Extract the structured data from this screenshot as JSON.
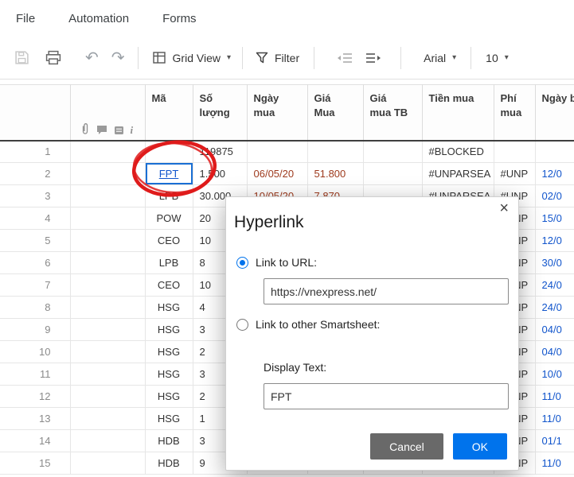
{
  "menu": {
    "items": [
      "File",
      "Automation",
      "Forms"
    ]
  },
  "toolbar": {
    "grid_view": "Grid View",
    "filter": "Filter",
    "font_name": "Arial",
    "font_size": "10"
  },
  "icons": {
    "undo": "↶",
    "redo": "↷",
    "caret": "▾",
    "close": "×",
    "info": "i"
  },
  "grid": {
    "columns": [
      {
        "key": "ma",
        "label": "Mã"
      },
      {
        "key": "so_luong",
        "label": "Số lượng"
      },
      {
        "key": "ngay_mua",
        "label": "Ngày mua"
      },
      {
        "key": "gia_mua",
        "label": "Giá Mua"
      },
      {
        "key": "gia_mua_tb",
        "label": "Giá mua TB"
      },
      {
        "key": "tien_mua",
        "label": "Tiền mua"
      },
      {
        "key": "phi_mua",
        "label": "Phí mua"
      },
      {
        "key": "ngay_ban",
        "label": "Ngày bán"
      }
    ],
    "rows": [
      {
        "num": "1",
        "ma": "",
        "so_luong": "119875",
        "ngay_mua": "",
        "gia_mua": "",
        "gia_mua_tb": "",
        "tien_mua": "#BLOCKED",
        "phi_mua": "",
        "ngay_ban": ""
      },
      {
        "num": "2",
        "ma": "FPT",
        "ma_link": true,
        "so_luong": "1.500",
        "ngay_mua": "06/05/20",
        "gia_mua": "51.800",
        "gia_mua_tb": "",
        "tien_mua": "#UNPARSEA",
        "phi_mua": "#UNP",
        "ngay_ban": "12/0"
      },
      {
        "num": "3",
        "ma": "LPB",
        "so_luong": "30.000",
        "ngay_mua": "10/05/20",
        "gia_mua": "7.870",
        "gia_mua_tb": "",
        "tien_mua": "#UNPARSEA",
        "phi_mua": "#UNP",
        "ngay_ban": "02/0"
      },
      {
        "num": "4",
        "ma": "POW",
        "so_luong": "20",
        "phi_mua": "#UNP",
        "ngay_ban": "15/0"
      },
      {
        "num": "5",
        "ma": "CEO",
        "so_luong": "10",
        "phi_mua": "#UNP",
        "ngay_ban": "12/0"
      },
      {
        "num": "6",
        "ma": "LPB",
        "so_luong": "8",
        "phi_mua": "#UNP",
        "ngay_ban": "30/0"
      },
      {
        "num": "7",
        "ma": "CEO",
        "so_luong": "10",
        "phi_mua": "#UNP",
        "ngay_ban": "24/0"
      },
      {
        "num": "8",
        "ma": "HSG",
        "so_luong": "4",
        "phi_mua": "#UNP",
        "ngay_ban": "24/0"
      },
      {
        "num": "9",
        "ma": "HSG",
        "so_luong": "3",
        "phi_mua": "#UNP",
        "ngay_ban": "04/0"
      },
      {
        "num": "10",
        "ma": "HSG",
        "so_luong": "2",
        "phi_mua": "#UNP",
        "ngay_ban": "04/0"
      },
      {
        "num": "11",
        "ma": "HSG",
        "so_luong": "3",
        "phi_mua": "#UNP",
        "ngay_ban": "10/0"
      },
      {
        "num": "12",
        "ma": "HSG",
        "so_luong": "2",
        "phi_mua": "#UNP",
        "ngay_ban": "11/0"
      },
      {
        "num": "13",
        "ma": "HSG",
        "so_luong": "1",
        "phi_mua": "#UNP",
        "ngay_ban": "11/0"
      },
      {
        "num": "14",
        "ma": "HDB",
        "so_luong": "3",
        "phi_mua": "#UNP",
        "ngay_ban": "01/1"
      },
      {
        "num": "15",
        "ma": "HDB",
        "so_luong": "9",
        "phi_mua": "#UNP",
        "ngay_ban": "11/0"
      }
    ]
  },
  "dialog": {
    "title": "Hyperlink",
    "link_url_label": "Link to URL:",
    "url_value": "https://vnexpress.net/",
    "link_sheet_label": "Link to other Smartsheet:",
    "display_text_label": "Display Text:",
    "display_text_value": "FPT",
    "cancel": "Cancel",
    "ok": "OK"
  },
  "colors": {
    "accent_blue": "#0073ec",
    "link_blue": "#1155cc",
    "error_text": "#9e3a1d",
    "annotation_red": "#df1b1b",
    "header_rule": "#3f3f3f"
  }
}
